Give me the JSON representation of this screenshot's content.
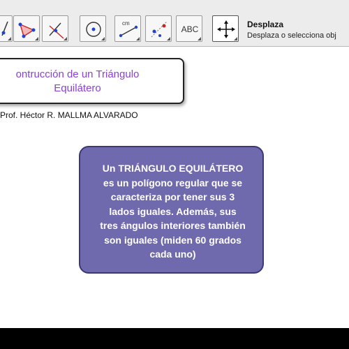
{
  "toolbar": {
    "tools": [
      {
        "icon": "line-icon"
      },
      {
        "icon": "polygon-icon"
      },
      {
        "icon": "perpendicular-icon"
      },
      {
        "icon": "circle-icon"
      },
      {
        "icon": "distance-icon",
        "label": "cm"
      },
      {
        "icon": "reflect-icon"
      },
      {
        "icon": "text-icon",
        "label": "ABC"
      },
      {
        "icon": "move-icon"
      }
    ],
    "active_tool_name": "Desplaza",
    "active_tool_help": "Desplaza o selecciona obj"
  },
  "canvas": {
    "title_box": {
      "lines": [
        "ontrucción de un Triángulo",
        "Equilátero"
      ]
    },
    "author": "Prof. Héctor R. MALLMA ALVARADO",
    "info_box": {
      "lines": [
        "Un TRIÁNGULO EQUILÁTERO",
        "es un polígono regular que se",
        "caracteriza por tener sus 3",
        "lados iguales. Además, sus",
        "tres ángulos interiores también",
        "son iguales (miden 60 grados",
        "cada uno)"
      ]
    }
  },
  "colors": {
    "title_text": "#8a3fd6",
    "info_box_fill": "#6f69ad",
    "info_box_border": "#3c3775"
  }
}
